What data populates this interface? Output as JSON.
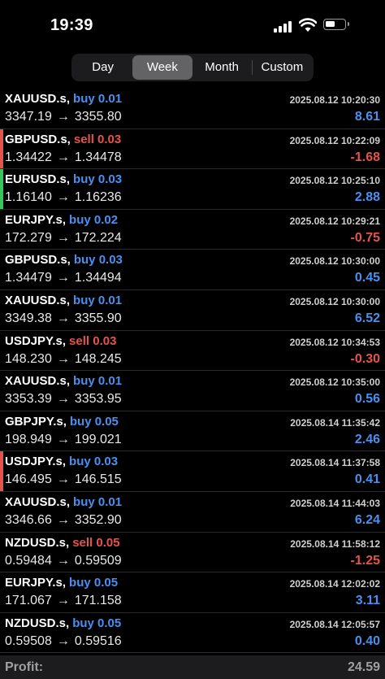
{
  "status": {
    "time": "19:39"
  },
  "tabs": [
    {
      "label": "Day"
    },
    {
      "label": "Week",
      "active": true
    },
    {
      "label": "Month"
    },
    {
      "label": "Custom"
    }
  ],
  "trades": [
    {
      "symbol": "XAUUSD.s,",
      "direction": "buy",
      "side_label": "buy 0.01",
      "open": "3347.19",
      "close": "3355.80",
      "time": "2025.08.12 10:20:30",
      "profit": "8.61",
      "marker": null
    },
    {
      "symbol": "GBPUSD.s,",
      "direction": "sell",
      "side_label": "sell 0.03",
      "open": "1.34422",
      "close": "1.34478",
      "time": "2025.08.12 10:22:09",
      "profit": "-1.68",
      "marker": "#e5534b"
    },
    {
      "symbol": "EURUSD.s,",
      "direction": "buy",
      "side_label": "buy 0.03",
      "open": "1.16140",
      "close": "1.16236",
      "time": "2025.08.12 10:25:10",
      "profit": "2.88",
      "marker": "#34c759"
    },
    {
      "symbol": "EURJPY.s,",
      "direction": "buy",
      "side_label": "buy 0.02",
      "open": "172.279",
      "close": "172.224",
      "time": "2025.08.12 10:29:21",
      "profit": "-0.75",
      "marker": null
    },
    {
      "symbol": "GBPUSD.s,",
      "direction": "buy",
      "side_label": "buy 0.03",
      "open": "1.34479",
      "close": "1.34494",
      "time": "2025.08.12 10:30:00",
      "profit": "0.45",
      "marker": null
    },
    {
      "symbol": "XAUUSD.s,",
      "direction": "buy",
      "side_label": "buy 0.01",
      "open": "3349.38",
      "close": "3355.90",
      "time": "2025.08.12 10:30:00",
      "profit": "6.52",
      "marker": null
    },
    {
      "symbol": "USDJPY.s,",
      "direction": "sell",
      "side_label": "sell 0.03",
      "open": "148.230",
      "close": "148.245",
      "time": "2025.08.12 10:34:53",
      "profit": "-0.30",
      "marker": null
    },
    {
      "symbol": "XAUUSD.s,",
      "direction": "buy",
      "side_label": "buy 0.01",
      "open": "3353.39",
      "close": "3353.95",
      "time": "2025.08.12 10:35:00",
      "profit": "0.56",
      "marker": null
    },
    {
      "symbol": "GBPJPY.s,",
      "direction": "buy",
      "side_label": "buy 0.05",
      "open": "198.949",
      "close": "199.021",
      "time": "2025.08.14 11:35:42",
      "profit": "2.46",
      "marker": null
    },
    {
      "symbol": "USDJPY.s,",
      "direction": "buy",
      "side_label": "buy 0.03",
      "open": "146.495",
      "close": "146.515",
      "time": "2025.08.14 11:37:58",
      "profit": "0.41",
      "marker": "#e5534b"
    },
    {
      "symbol": "XAUUSD.s,",
      "direction": "buy",
      "side_label": "buy 0.01",
      "open": "3346.66",
      "close": "3352.90",
      "time": "2025.08.14 11:44:03",
      "profit": "6.24",
      "marker": null
    },
    {
      "symbol": "NZDUSD.s,",
      "direction": "sell",
      "side_label": "sell 0.05",
      "open": "0.59484",
      "close": "0.59509",
      "time": "2025.08.14 11:58:12",
      "profit": "-1.25",
      "marker": null
    },
    {
      "symbol": "EURJPY.s,",
      "direction": "buy",
      "side_label": "buy 0.05",
      "open": "171.067",
      "close": "171.158",
      "time": "2025.08.14 12:02:02",
      "profit": "3.11",
      "marker": null
    },
    {
      "symbol": "NZDUSD.s,",
      "direction": "buy",
      "side_label": "buy 0.05",
      "open": "0.59508",
      "close": "0.59516",
      "time": "2025.08.14 12:05:57",
      "profit": "0.40",
      "marker": null
    }
  ],
  "footer": {
    "label": "Profit:",
    "value": "24.59"
  },
  "colors": {
    "buy": "#4a90f0",
    "sell": "#e5534b",
    "background": "#000000"
  },
  "icons": [
    "signal-icon",
    "wifi-icon",
    "battery-icon",
    "arrow-right-icon"
  ]
}
